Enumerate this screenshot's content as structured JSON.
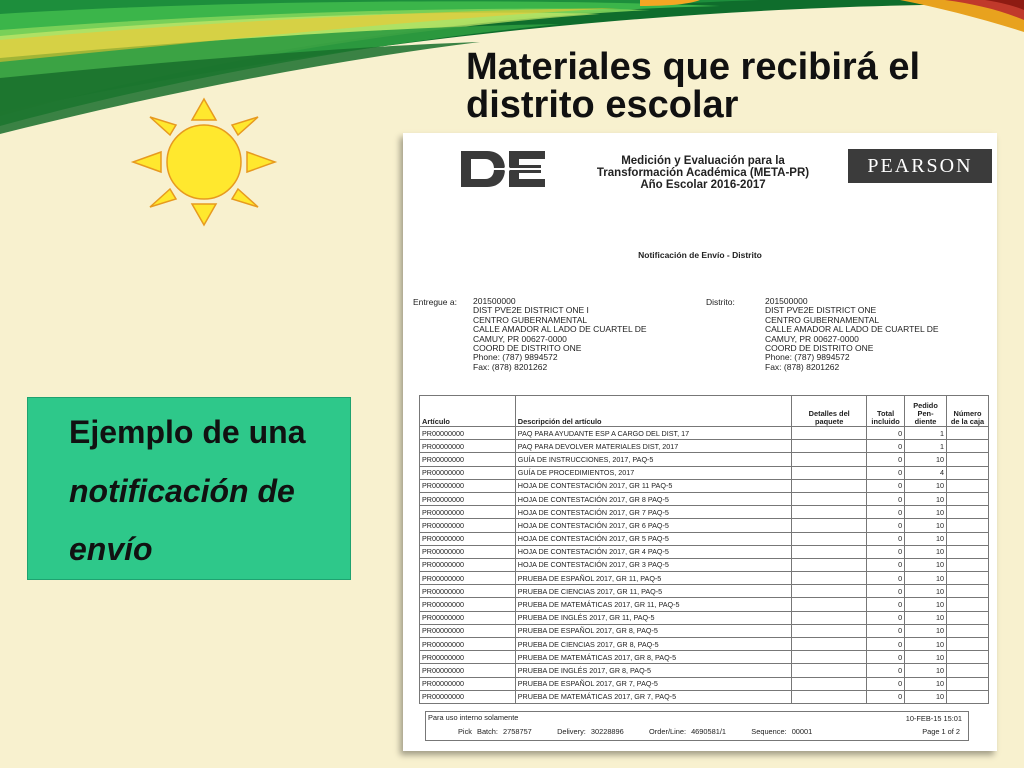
{
  "slide": {
    "title_line1": "Materiales que recibirá el",
    "title_line2": "distrito escolar",
    "box_line1": "Ejemplo de una",
    "box_line2": "notificación de",
    "box_line3": "envío",
    "colors": {
      "background": "#f8f1cf",
      "green_box": "#2ec88a",
      "sun": "#ffe82e"
    }
  },
  "doc": {
    "header_line1": "Medición y Evaluación para la",
    "header_line2": "Transformación Académica (META-PR)",
    "header_line3": "Año Escolar 2016-2017",
    "pearson": "PEARSON",
    "notification_title": "Notificación de Envío - Distrito",
    "ship_to_label": "Entregue a:",
    "district_label": "Distrito:",
    "ship_to": [
      "201500000",
      "DIST PVE2E DISTRICT ONE I",
      "CENTRO GUBERNAMENTAL",
      "CALLE AMADOR AL LADO DE CUARTEL DE",
      "CAMUY, PR  00627-0000",
      "COORD DE DISTRITO ONE",
      "Phone: (787) 9894572",
      "Fax:  (878) 8201262"
    ],
    "district": [
      "201500000",
      "DIST PVE2E DISTRICT ONE",
      "CENTRO GUBERNAMENTAL",
      "CALLE AMADOR AL LADO DE CUARTEL DE",
      "CAMUY, PR  00627-0000",
      "COORD DE DISTRITO ONE",
      "Phone: (787) 9894572",
      "Fax:  (878) 8201262"
    ],
    "columns": [
      "Artículo",
      "Descripción del artículo",
      "Detalles del paquete",
      "Total incluido",
      "Pedido Pen-diente",
      "Número de la caja"
    ],
    "rows": [
      {
        "article": "PR00000000",
        "desc": "PAQ PARA AYUDANTE ESP A CARGO DEL DIST, 17",
        "total": "0",
        "pending": "1"
      },
      {
        "article": "PR00000000",
        "desc": "PAQ PARA DEVOLVER MATERIALES DIST, 2017",
        "total": "0",
        "pending": "1"
      },
      {
        "article": "PR00000000",
        "desc": "GUÍA DE INSTRUCCIONES, 2017, PAQ-5",
        "total": "0",
        "pending": "10"
      },
      {
        "article": "PR00000000",
        "desc": "GUÍA DE PROCEDIMIENTOS, 2017",
        "total": "0",
        "pending": "4"
      },
      {
        "article": "PR00000000",
        "desc": "HOJA DE CONTESTACIÓN 2017, GR 11 PAQ-5",
        "total": "0",
        "pending": "10"
      },
      {
        "article": "PR00000000",
        "desc": "HOJA DE CONTESTACIÓN 2017, GR 8 PAQ-5",
        "total": "0",
        "pending": "10"
      },
      {
        "article": "PR00000000",
        "desc": "HOJA DE CONTESTACIÓN 2017, GR 7 PAQ-5",
        "total": "0",
        "pending": "10"
      },
      {
        "article": "PR00000000",
        "desc": "HOJA DE CONTESTACIÓN 2017, GR 6 PAQ-5",
        "total": "0",
        "pending": "10"
      },
      {
        "article": "PR00000000",
        "desc": "HOJA DE CONTESTACIÓN 2017, GR 5 PAQ-5",
        "total": "0",
        "pending": "10"
      },
      {
        "article": "PR00000000",
        "desc": "HOJA DE CONTESTACIÓN 2017, GR 4 PAQ-5",
        "total": "0",
        "pending": "10"
      },
      {
        "article": "PR00000000",
        "desc": "HOJA DE CONTESTACIÓN 2017, GR 3 PAQ-5",
        "total": "0",
        "pending": "10"
      },
      {
        "article": "PR00000000",
        "desc": "PRUEBA DE ESPAÑOL 2017, GR 11, PAQ-5",
        "total": "0",
        "pending": "10"
      },
      {
        "article": "PR00000000",
        "desc": "PRUEBA DE CIENCIAS 2017, GR 11, PAQ-5",
        "total": "0",
        "pending": "10"
      },
      {
        "article": "PR00000000",
        "desc": "PRUEBA DE MATEMÁTICAS 2017, GR 11, PAQ-5",
        "total": "0",
        "pending": "10"
      },
      {
        "article": "PR00000000",
        "desc": "PRUEBA DE INGLÉS 2017, GR 11, PAQ-5",
        "total": "0",
        "pending": "10"
      },
      {
        "article": "PR00000000",
        "desc": "PRUEBA DE ESPAÑOL 2017, GR 8, PAQ-5",
        "total": "0",
        "pending": "10"
      },
      {
        "article": "PR00000000",
        "desc": "PRUEBA DE CIENCIAS 2017, GR 8, PAQ-5",
        "total": "0",
        "pending": "10"
      },
      {
        "article": "PR00000000",
        "desc": "PRUEBA DE MATEMÁTICAS 2017, GR 8, PAQ-5",
        "total": "0",
        "pending": "10"
      },
      {
        "article": "PR00000000",
        "desc": "PRUEBA DE INGLÉS 2017, GR 8, PAQ-5",
        "total": "0",
        "pending": "10"
      },
      {
        "article": "PR00000000",
        "desc": "PRUEBA DE ESPAÑOL 2017, GR 7, PAQ-5",
        "total": "0",
        "pending": "10"
      },
      {
        "article": "PR00000000",
        "desc": "PRUEBA DE MATEMÁTICAS 2017, GR 7, PAQ-5",
        "total": "0",
        "pending": "10"
      }
    ],
    "footer": {
      "internal": "Para uso interno solamente",
      "datetime": "10-FEB-15 15:01",
      "pick_batch": "Pick Batch:  2758757",
      "delivery": "Delivery:  30228896",
      "order_line": "Order/Line:  4690581/1",
      "sequence": "Sequence:  00001",
      "page": "Page 1 of 2"
    }
  }
}
